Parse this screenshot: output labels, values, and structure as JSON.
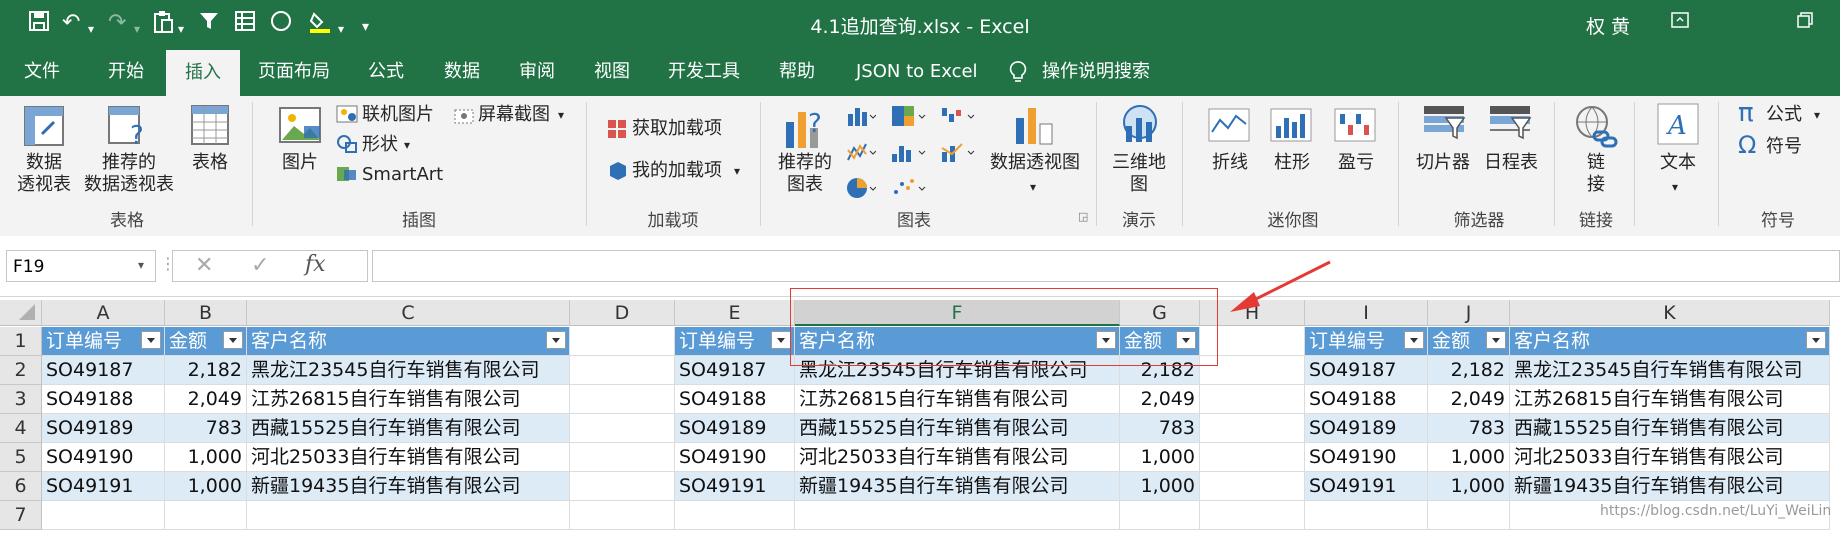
{
  "window": {
    "title": "4.1追加查询.xlsx  -  Excel",
    "user": "权 黄"
  },
  "tabs": [
    "文件",
    "开始",
    "插入",
    "页面布局",
    "公式",
    "数据",
    "审阅",
    "视图",
    "开发工具",
    "帮助",
    "JSON to Excel",
    "操作说明搜索"
  ],
  "active_tab": "插入",
  "ribbon": {
    "tables": {
      "pivot": "数据\n透视表",
      "recommended_pivot": "推荐的\n数据透视表",
      "table": "表格",
      "group": "表格"
    },
    "illustrations": {
      "picture": "图片",
      "online_picture": "联机图片",
      "screenshot": "屏幕截图",
      "shapes": "形状",
      "smartart": "SmartArt",
      "group": "插图"
    },
    "addins": {
      "get": "获取加载项",
      "my": "我的加载项",
      "group": "加载项"
    },
    "charts": {
      "recommended": "推荐的\n图表",
      "pivot_chart": "数据透视图",
      "group": "图表"
    },
    "tours": {
      "map3d": "三维地\n图",
      "group": "演示"
    },
    "sparklines": {
      "line": "折线",
      "column": "柱形",
      "winloss": "盈亏",
      "group": "迷你图"
    },
    "filters": {
      "slicer": "切片器",
      "timeline": "日程表",
      "group": "筛选器"
    },
    "links": {
      "link": "链\n接",
      "group": "链接"
    },
    "text": {
      "text": "文本"
    },
    "symbols": {
      "equation": "公式",
      "symbol": "符号",
      "group": "符号"
    }
  },
  "formula_bar": {
    "name_box": "F19",
    "fx": "fx",
    "value": ""
  },
  "columns": [
    {
      "label": "A"
    },
    {
      "label": "B"
    },
    {
      "label": "C"
    },
    {
      "label": "D"
    },
    {
      "label": "E"
    },
    {
      "label": "F"
    },
    {
      "label": "G"
    },
    {
      "label": "H"
    },
    {
      "label": "I"
    },
    {
      "label": "J"
    },
    {
      "label": "K"
    }
  ],
  "selected_column": "F",
  "rows": [
    "1",
    "2",
    "3",
    "4",
    "5",
    "6",
    "7"
  ],
  "table1": {
    "headers": [
      "订单编号",
      "金额",
      "客户名称"
    ],
    "rows": [
      [
        "SO49187",
        "2,182",
        "黑龙江23545自行车销售有限公司"
      ],
      [
        "SO49188",
        "2,049",
        "江苏26815自行车销售有限公司"
      ],
      [
        "SO49189",
        "783",
        "西藏15525自行车销售有限公司"
      ],
      [
        "SO49190",
        "1,000",
        "河北25033自行车销售有限公司"
      ],
      [
        "SO49191",
        "1,000",
        "新疆19435自行车销售有限公司"
      ]
    ]
  },
  "table2": {
    "headers": [
      "订单编号",
      "客户名称",
      "金额"
    ],
    "rows": [
      [
        "SO49187",
        "黑龙江23545自行车销售有限公司",
        "2,182"
      ],
      [
        "SO49188",
        "江苏26815自行车销售有限公司",
        "2,049"
      ],
      [
        "SO49189",
        "西藏15525自行车销售有限公司",
        "783"
      ],
      [
        "SO49190",
        "河北25033自行车销售有限公司",
        "1,000"
      ],
      [
        "SO49191",
        "新疆19435自行车销售有限公司",
        "1,000"
      ]
    ]
  },
  "table3": {
    "headers": [
      "订单编号",
      "金额",
      "客户名称"
    ],
    "rows": [
      [
        "SO49187",
        "2,182",
        "黑龙江23545自行车销售有限公司"
      ],
      [
        "SO49188",
        "2,049",
        "江苏26815自行车销售有限公司"
      ],
      [
        "SO49189",
        "783",
        "西藏15525自行车销售有限公司"
      ],
      [
        "SO49190",
        "1,000",
        "河北25033自行车销售有限公司"
      ],
      [
        "SO49191",
        "1,000",
        "新疆19435自行车销售有限公司"
      ]
    ]
  },
  "watermark": "https://blog.csdn.net/LuYi_WeiLin",
  "colors": {
    "excel_green": "#217346",
    "table_header": "#5b9bd5",
    "table_band": "#ddebf7",
    "annotation_red": "#e53935"
  }
}
